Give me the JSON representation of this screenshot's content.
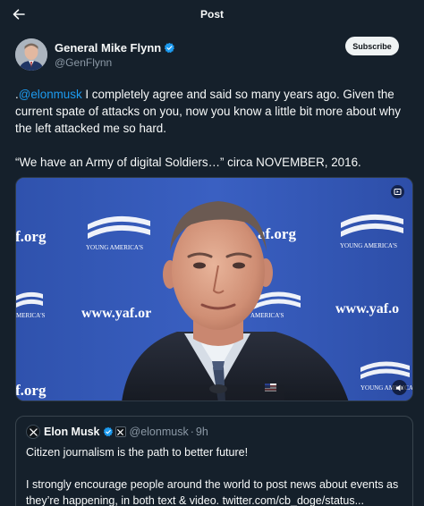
{
  "header": {
    "title": "Post"
  },
  "author": {
    "name": "General Mike Flynn",
    "handle": "@GenFlynn",
    "verified_color": "#1d9bf0"
  },
  "subscribe_label": "Subscribe",
  "tweet": {
    "prefix": ".",
    "mention": "@elonmusk",
    "text1_rest": " I completely agree and said so many years ago. Given the current spate of attacks on you, now you know a little bit more about why the left attacked me so hard.",
    "text2": "“We have an Army of digital Soldiers…” circa NOVEMBER, 2016."
  },
  "media": {
    "backdrop_texts": {
      "org_left_top": "f.org",
      "org_mid_top": "af.org",
      "url_left": "www.yaf.or",
      "url_right": "www.yaf.o",
      "org_left_bottom": "f.org",
      "logo_text": "YOUNG AMERICA'S",
      "logo_text_small": "MERICA'S",
      "logo_text_mid": "AMERICA'S"
    },
    "icons": [
      "gif-icon",
      "speaker-icon"
    ]
  },
  "quote": {
    "name": "Elon Musk",
    "handle": "@elonmusk",
    "separator": "·",
    "time": "9h",
    "line1": "Citizen journalism is the path to better future!",
    "line2": "I strongly encourage people around the world to post news about events as they’re happening, in both text & video. twitter.com/cb_doge/status..."
  },
  "colors": {
    "background": "#15202b",
    "accent": "#1d9bf0",
    "muted": "#8b98a5",
    "backdrop_blue": "#3559b8"
  }
}
